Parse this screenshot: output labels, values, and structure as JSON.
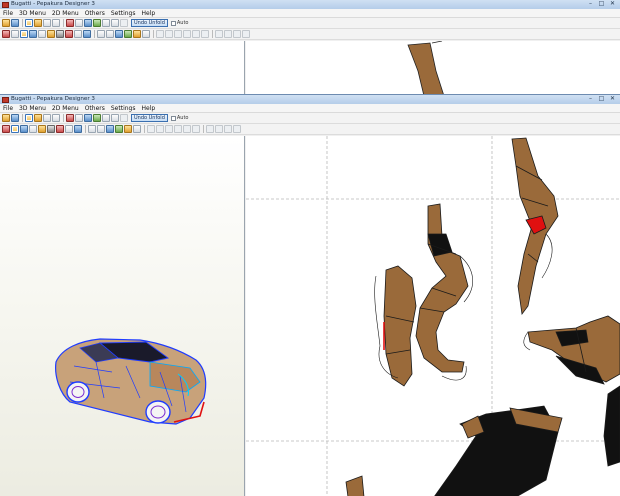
{
  "back_window": {
    "title": "Bugatti - Pepakura Designer 3",
    "controls": [
      "–",
      "□",
      "✕"
    ],
    "menu": [
      "File",
      "3D Menu",
      "2D Menu",
      "Others",
      "Settings",
      "Help"
    ],
    "undo_label": "Undo Unfold",
    "auto_label": "Auto"
  },
  "front_window": {
    "title": "Bugatti - Pepakura Designer 3",
    "controls": [
      "–",
      "□",
      "✕"
    ],
    "menu": [
      "File",
      "3D Menu",
      "2D Menu",
      "Others",
      "Settings",
      "Help"
    ],
    "undo_label": "Undo Unfold",
    "auto_label": "Auto"
  },
  "colors": {
    "part_fill": "#9a6a3a",
    "dark_part_fill": "#111111",
    "wire_blue": "#1f3cff",
    "highlight_red": "#e01010",
    "page_guide": "#b9b9b9"
  },
  "icons": {
    "undo_toggle": "undo-icon",
    "auto_checkbox": "checkbox-icon"
  }
}
